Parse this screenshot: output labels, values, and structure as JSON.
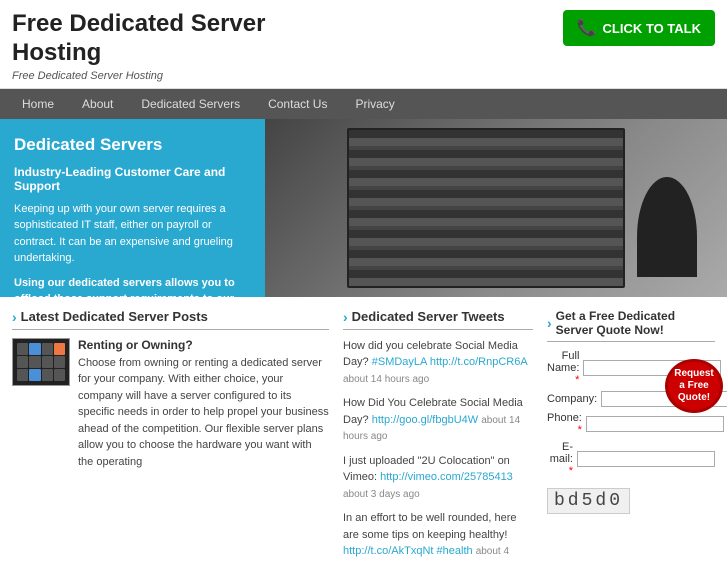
{
  "header": {
    "title_line1": "Free Dedicated Server",
    "title_line2": "Hosting",
    "subtitle": "Free Dedicated Server Hosting",
    "cta_button": "CLICK TO TALK"
  },
  "nav": {
    "items": [
      {
        "label": "Home",
        "active": false
      },
      {
        "label": "About",
        "active": false
      },
      {
        "label": "Dedicated Servers",
        "active": false
      },
      {
        "label": "Contact Us",
        "active": false
      },
      {
        "label": "Privacy",
        "active": false
      }
    ]
  },
  "hero": {
    "title": "Dedicated Servers",
    "tagline": "Industry-Leading Customer Care and Support",
    "desc": "Keeping up with your own server requires a sophisticated IT staff, either on payroll or contract. It can be an expensive and grueling undertaking.",
    "highlight": "Using our dedicated servers allows you to offload those support requirements to our expert support staff."
  },
  "posts": {
    "heading": "Latest Dedicated Server Posts",
    "items": [
      {
        "title": "Renting or Owning?",
        "content": "Choose from owning or renting a dedicated server for your company. With either choice, your company will have a server configured to its specific needs in order to help propel your business ahead of the competition. Our flexible server plans allow you to choose the hardware you want with the operating"
      }
    ]
  },
  "tweets": {
    "heading": "Dedicated Server Tweets",
    "items": [
      {
        "text": "How did you celebrate Social Media Day?",
        "link_text": "#SMDayLA http://t.co/RnpCR6A",
        "time": "about 14 hours ago"
      },
      {
        "text": "How Did You Celebrate Social Media Day?",
        "link_text": "http://goo.gl/fbgbU4W",
        "time": "about 14 hours ago"
      },
      {
        "text": "I just uploaded \"2U Colocation\" on Vimeo:",
        "link_text": "http://vimeo.com/25785413",
        "time": "about 3 days ago"
      },
      {
        "text": "In an effort to be well rounded, here are some tips on keeping healthy!",
        "link_text": "http://t.co/AkTxqNt #health",
        "time": "about 4"
      }
    ]
  },
  "quote_form": {
    "heading": "Get a Free Dedicated Server Quote Now!",
    "fields": [
      {
        "label": "Full Name:",
        "required": true
      },
      {
        "label": "Company:",
        "required": false
      },
      {
        "label": "Phone:",
        "required": true
      },
      {
        "label": "E-mail:",
        "required": true
      }
    ],
    "button": "Request a Free Quote!",
    "captcha": "bd5d0"
  }
}
